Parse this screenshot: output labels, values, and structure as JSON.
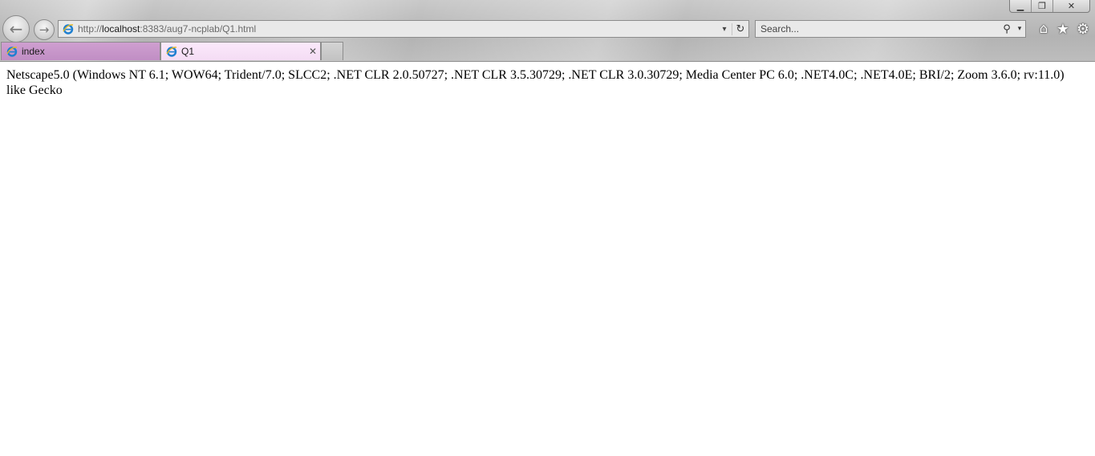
{
  "window": {
    "minimize_glyph": "▁",
    "restore_glyph": "❐",
    "close_glyph": "✕"
  },
  "nav": {
    "back_glyph": "←",
    "forward_glyph": "→"
  },
  "address": {
    "url_prefix": "http://",
    "url_host": "localhost",
    "url_rest": ":8383/aug7-ncplab/Q1.html",
    "dropdown_glyph": "▾",
    "refresh_glyph": "↻"
  },
  "search": {
    "placeholder": "Search...",
    "search_glyph": "⚲",
    "dropdown_glyph": "▾"
  },
  "toolbar": {
    "home_glyph": "⌂",
    "favorites_glyph": "★",
    "tools_glyph": "⚙"
  },
  "tabs": [
    {
      "label": "index",
      "icon": "ie-icon"
    },
    {
      "label": "Q1",
      "icon": "ie-icon",
      "close_glyph": "✕"
    }
  ],
  "page": {
    "text": "Netscape5.0 (Windows NT 6.1; WOW64; Trident/7.0; SLCC2; .NET CLR 2.0.50727; .NET CLR 3.5.30729; .NET CLR 3.0.30729; Media Center PC 6.0; .NET4.0C; .NET4.0E; BRI/2; Zoom 3.6.0; rv:11.0) like Gecko"
  },
  "colors": {
    "tab_index_bg": "#c08ec4",
    "tab_active_bg": "#f4dcf4",
    "ie_blue": "#1e7fd0",
    "ie_gold": "#e8b820"
  }
}
